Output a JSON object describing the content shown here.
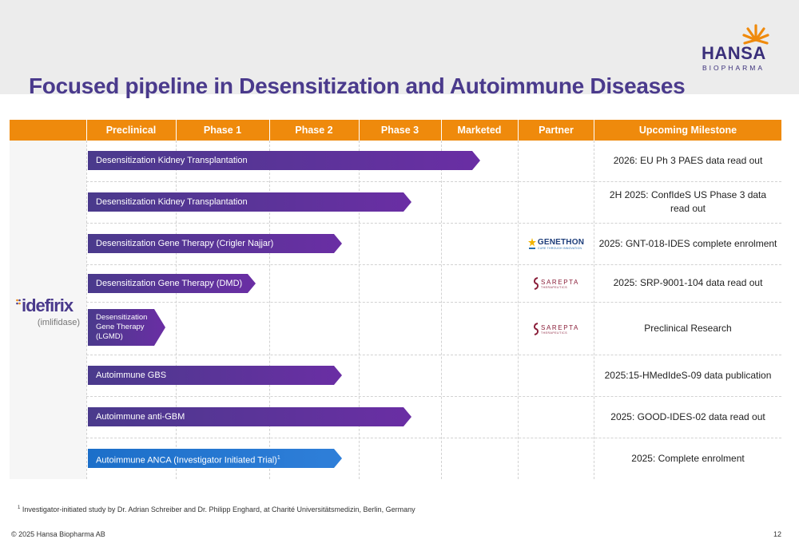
{
  "title": "Focused pipeline in Desensitization and Autoimmune Diseases",
  "logo": {
    "name": "HANSA",
    "sub": "BIOPHARMA"
  },
  "product": {
    "name": "idefirix",
    "sub": "(imlifidase)"
  },
  "columns": [
    "Preclinical",
    "Phase 1",
    "Phase 2",
    "Phase 3",
    "Marketed",
    "Partner",
    "Upcoming Milestone"
  ],
  "rows": [
    {
      "program": "Desensitization Kidney Transplantation",
      "stage": 5,
      "partner": "",
      "milestone": "2026: EU Ph 3 PAES data read out",
      "color": "purple"
    },
    {
      "program": "Desensitization Kidney Transplantation",
      "stage": 4,
      "partner": "",
      "milestone": "2H 2025: ConfIdeS US Phase 3 data read out",
      "color": "purple"
    },
    {
      "program": "Desensitization Gene Therapy (Crigler Najjar)",
      "stage": 3,
      "partner": "GENETHON",
      "milestone": "2025: GNT-018-IDES complete enrolment",
      "color": "purple"
    },
    {
      "program": "Desensitization  Gene Therapy (DMD)",
      "stage": 2,
      "partner": "SAREPTA",
      "milestone": "2025: SRP-9001-104 data read out",
      "color": "purple"
    },
    {
      "program_lines": [
        "Desensitization",
        "Gene Therapy",
        "(LGMD)"
      ],
      "stage": 1,
      "partner": "SAREPTA",
      "milestone": "Preclinical Research",
      "color": "purple"
    },
    {
      "program": "Autoimmune GBS",
      "stage": 3,
      "partner": "",
      "milestone": "2025:15-HMedIdeS-09 data publication",
      "color": "purple"
    },
    {
      "program": "Autoimmune anti-GBM",
      "stage": 4,
      "partner": "",
      "milestone": "2025: GOOD-IDES-02 data read out",
      "color": "purple"
    },
    {
      "program": "Autoimmune ANCA (Investigator Initiated Trial)",
      "program_sup": "1",
      "stage": 3,
      "partner": "",
      "milestone": "2025: Complete enrolment",
      "color": "blue"
    }
  ],
  "partners": {
    "genethon": "GENETHON",
    "genethon_tag": "CURE THROUGH INNOVATION",
    "sarepta": "SAREPTA",
    "sarepta_tag": "THERAPEUTICS"
  },
  "footnote": {
    "sup": "1",
    "text": " Investigator-initiated study by Dr. Adrian Schreiber and Dr. Philipp Enghard, at Charité Universitätsmedizin, Berlin, Germany"
  },
  "copyright": "© 2025 Hansa Biopharma AB",
  "page_number": "12",
  "colors": {
    "accent_orange": "#ef8a0c",
    "brand_purple": "#4a3a8c",
    "bar_blue": "#1c6fc9"
  }
}
